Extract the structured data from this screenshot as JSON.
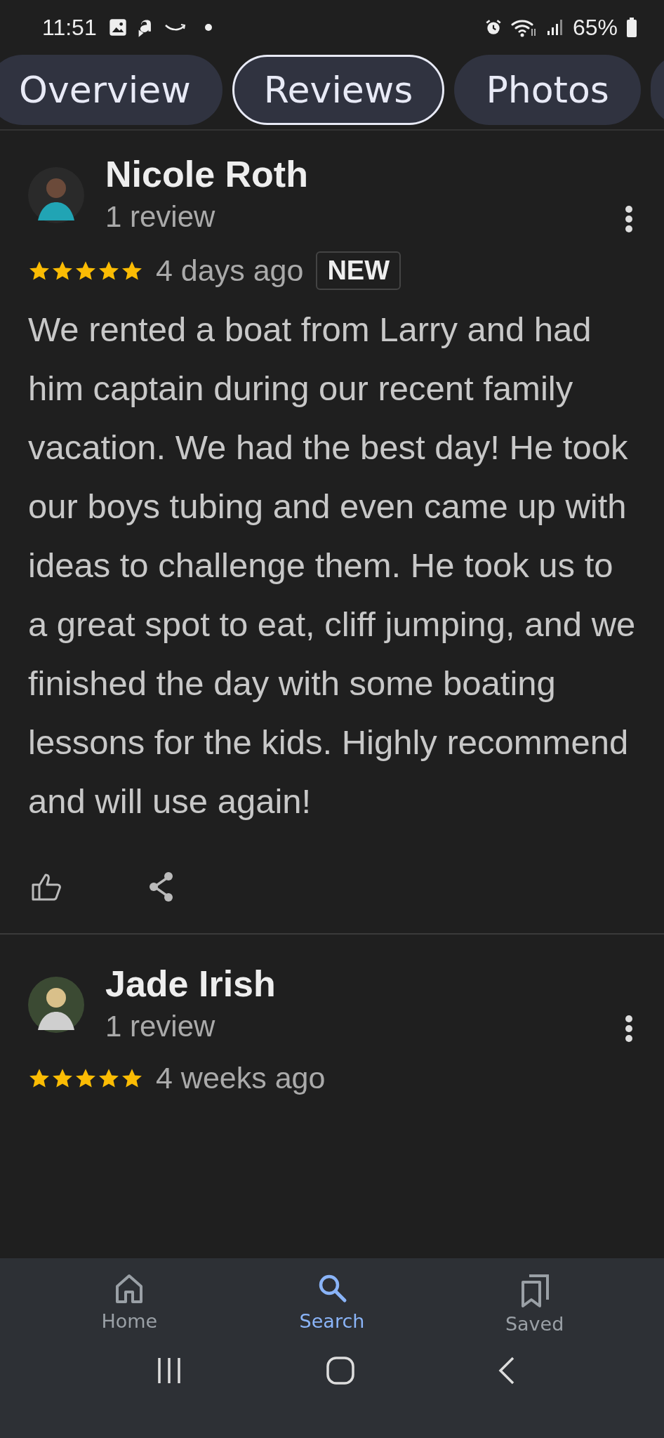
{
  "status_bar": {
    "time": "11:51",
    "battery": "65%"
  },
  "tabs": [
    {
      "label": "Overview",
      "selected": false
    },
    {
      "label": "Reviews",
      "selected": true
    },
    {
      "label": "Photos",
      "selected": false
    }
  ],
  "reviews": [
    {
      "name": "Nicole Roth",
      "count": "1 review",
      "stars": 5,
      "time": "4 days ago",
      "badge": "NEW",
      "text": "We rented a boat from Larry and had him captain during our recent family vacation. We had the best day! He took our boys tubing and even came up with ideas to challenge them. He took us to a great spot to eat, cliff jumping, and we finished the day with some boating lessons for the kids. Highly recommend and will use again!"
    },
    {
      "name": "Jade Irish",
      "count": "1 review",
      "stars": 5,
      "time": "4 weeks ago"
    }
  ],
  "bottom_nav": [
    {
      "label": "Home",
      "kind": "home",
      "selected": false
    },
    {
      "label": "Search",
      "kind": "search",
      "selected": true
    },
    {
      "label": "Saved",
      "kind": "saved",
      "selected": false
    }
  ]
}
